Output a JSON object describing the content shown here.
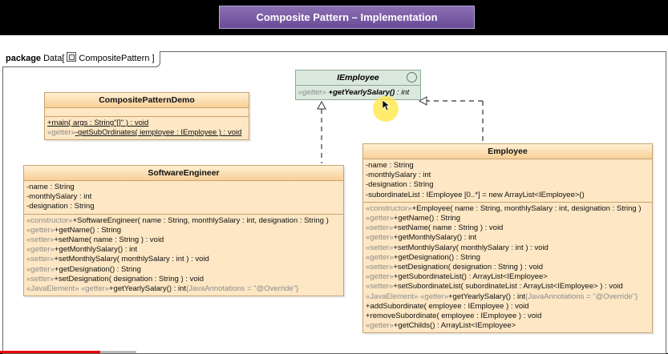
{
  "title": "Composite Pattern – Implementation",
  "package": {
    "keyword": "package",
    "name": "Data",
    "diagram": "CompositePattern"
  },
  "iemployee": {
    "name": "IEmployee",
    "op_stereo": "«getter»",
    "op": "+getYearlySalary()",
    "op_type": ": int"
  },
  "demo": {
    "name": "CompositePatternDemo",
    "ops": [
      {
        "stereo": "",
        "text": "+main( args : String\"[]\" ) : void"
      },
      {
        "stereo": "«getter»",
        "text": "-getSubOrdinates( iemployee : IEmployee ) : void"
      }
    ]
  },
  "engineer": {
    "name": "SoftwareEngineer",
    "attrs": [
      "-name : String",
      "-monthlySalary : int",
      "-designation : String"
    ],
    "ops": [
      {
        "stereo": "«constructor»",
        "text": "+SoftwareEngineer( name : String, monthlySalary : int, designation : String )",
        "suffix": ""
      },
      {
        "stereo": "«getter»",
        "text": "+getName() : String",
        "suffix": ""
      },
      {
        "stereo": "«setter»",
        "text": "+setName( name : String ) : void",
        "suffix": ""
      },
      {
        "stereo": "«getter»",
        "text": "+getMonthlySalary() : int",
        "suffix": ""
      },
      {
        "stereo": "«setter»",
        "text": "+setMonthlySalary( monthlySalary : int ) : void",
        "suffix": ""
      },
      {
        "stereo": "«getter»",
        "text": "+getDesignation() : String",
        "suffix": ""
      },
      {
        "stereo": "«setter»",
        "text": "+setDesignation( designation : String ) : void",
        "suffix": ""
      },
      {
        "stereo": "«JavaElement» «getter»",
        "text": "+getYearlySalary() : int",
        "suffix": "{JavaAnnotations = \"@Override\"}"
      }
    ]
  },
  "employee": {
    "name": "Employee",
    "attrs": [
      "-name : String",
      "-monthlySalary : int",
      "-designation : String",
      "-subordinateList : IEmployee [0..*] = new ArrayList<IEmployee>()"
    ],
    "ops": [
      {
        "stereo": "«constructor»",
        "text": "+Employee( name : String, monthlySalary : int, designation : String )",
        "suffix": ""
      },
      {
        "stereo": "«getter»",
        "text": "+getName() : String",
        "suffix": ""
      },
      {
        "stereo": "«setter»",
        "text": "+setName( name : String ) : void",
        "suffix": ""
      },
      {
        "stereo": "«getter»",
        "text": "+getMonthlySalary() : int",
        "suffix": ""
      },
      {
        "stereo": "«setter»",
        "text": "+setMonthlySalary( monthlySalary : int ) : void",
        "suffix": ""
      },
      {
        "stereo": "«getter»",
        "text": "+getDesignation() : String",
        "suffix": ""
      },
      {
        "stereo": "«setter»",
        "text": "+setDesignation( designation : String ) : void",
        "suffix": ""
      },
      {
        "stereo": "«getter»",
        "text": "+getSubordinateList() : ArrayList<IEmployee>",
        "suffix": ""
      },
      {
        "stereo": "«setter»",
        "text": "+setSubordinateList( subordinateList : ArrayList<IEmployee> ) : void",
        "suffix": ""
      },
      {
        "stereo": "«JavaElement» «getter»",
        "text": "+getYearlySalary() : int",
        "suffix": "{JavaAnnotations = \"@Override\"}"
      },
      {
        "stereo": "",
        "text": "+addSubordinate( employee : IEmployee ) : void",
        "suffix": ""
      },
      {
        "stereo": "",
        "text": "+removeSubordinate( employee : IEmployee ) : void",
        "suffix": ""
      },
      {
        "stereo": "«getter»",
        "text": "+getChilds() : ArrayList<IEmployee>",
        "suffix": ""
      }
    ]
  }
}
